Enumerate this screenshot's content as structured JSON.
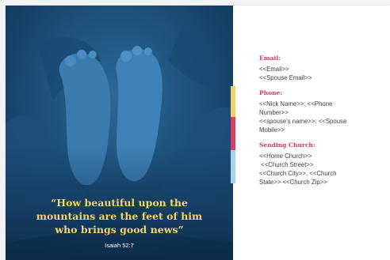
{
  "quote": {
    "lines": [
      "“How beautiful upon the",
      "mountains are the feet of him",
      "who brings good news”"
    ],
    "citation": "Isaiah 52:7"
  },
  "contact": {
    "email": {
      "heading": "Email:",
      "lines": [
        "<<Email>>",
        "<<Spouse Email>>"
      ]
    },
    "phone": {
      "heading": "Phone:",
      "lines": [
        "<<Nick Name>>: <<Phone",
        "Number>>",
        "<<spouse's name>>: <<Spouse",
        "Mobile>>"
      ]
    },
    "church": {
      "heading": "Sending Church:",
      "lines": [
        "<<Home Church>>",
        " <<Church Street>>",
        "<<Church City>>, <<Church",
        "State>> <<Church Zip>>"
      ]
    }
  },
  "colors": {
    "panel": "#123a5e",
    "quote_text": "#f3d36b",
    "heading": "#d43a66",
    "stripe_yellow": "#f2d264",
    "stripe_pink": "#d93b67",
    "stripe_blue": "#a9d2ee"
  }
}
